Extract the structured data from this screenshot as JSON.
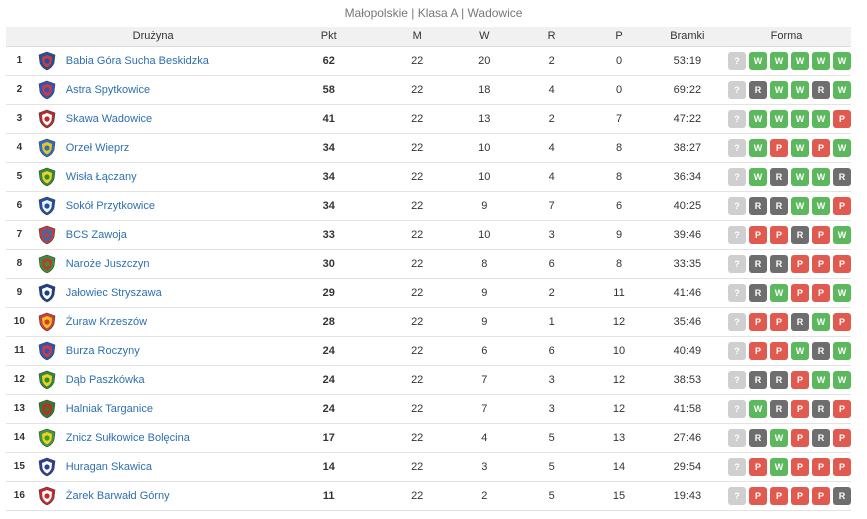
{
  "page_title": "Małopolskie | Klasa A | Wadowice",
  "headers": {
    "team": "Drużyna",
    "pkt": "Pkt",
    "m": "M",
    "w": "W",
    "r": "R",
    "p": "P",
    "goals": "Bramki",
    "form": "Forma"
  },
  "rows": [
    {
      "pos": "1",
      "team": "Babia Góra Sucha Beskidzka",
      "crest": "crest-babia-gora",
      "crest_colors": [
        "#1f4fa3",
        "#d23b3b"
      ],
      "pkt": "62",
      "m": "22",
      "w": "20",
      "r": "2",
      "p": "0",
      "goals": "53:19",
      "form": [
        "?",
        "W",
        "W",
        "W",
        "W",
        "W"
      ]
    },
    {
      "pos": "2",
      "team": "Astra Spytkowice",
      "crest": "crest-astra",
      "crest_colors": [
        "#2a56b8",
        "#d43a3a"
      ],
      "pkt": "58",
      "m": "22",
      "w": "18",
      "r": "4",
      "p": "0",
      "goals": "69:22",
      "form": [
        "?",
        "R",
        "W",
        "W",
        "R",
        "W"
      ]
    },
    {
      "pos": "3",
      "team": "Skawa Wadowice",
      "crest": "crest-skawa",
      "crest_colors": [
        "#b52a2a",
        "#ffffff"
      ],
      "pkt": "41",
      "m": "22",
      "w": "13",
      "r": "2",
      "p": "7",
      "goals": "47:22",
      "form": [
        "?",
        "W",
        "W",
        "W",
        "W",
        "P"
      ]
    },
    {
      "pos": "4",
      "team": "Orzeł Wieprz",
      "crest": "crest-orzel",
      "crest_colors": [
        "#2a6fc7",
        "#f0c419"
      ],
      "pkt": "34",
      "m": "22",
      "w": "10",
      "r": "4",
      "p": "8",
      "goals": "38:27",
      "form": [
        "?",
        "W",
        "P",
        "W",
        "P",
        "W"
      ]
    },
    {
      "pos": "5",
      "team": "Wisła Łączany",
      "crest": "crest-wisla",
      "crest_colors": [
        "#2e8b3d",
        "#f2d21c"
      ],
      "pkt": "34",
      "m": "22",
      "w": "10",
      "r": "4",
      "p": "8",
      "goals": "36:34",
      "form": [
        "?",
        "W",
        "R",
        "W",
        "W",
        "R"
      ]
    },
    {
      "pos": "6",
      "team": "Sokół Przytkowice",
      "crest": "crest-sokol",
      "crest_colors": [
        "#1f4fa3",
        "#f2f2f2"
      ],
      "pkt": "34",
      "m": "22",
      "w": "9",
      "r": "7",
      "p": "6",
      "goals": "40:25",
      "form": [
        "?",
        "R",
        "R",
        "W",
        "W",
        "P"
      ]
    },
    {
      "pos": "7",
      "team": "BCS Zawoja",
      "crest": "crest-bcs",
      "crest_colors": [
        "#c93a3a",
        "#2f6fb0"
      ],
      "pkt": "33",
      "m": "22",
      "w": "10",
      "r": "3",
      "p": "9",
      "goals": "39:46",
      "form": [
        "?",
        "P",
        "P",
        "R",
        "P",
        "W"
      ]
    },
    {
      "pos": "8",
      "team": "Naroże Juszczyn",
      "crest": "crest-naroze",
      "crest_colors": [
        "#3a8f3a",
        "#c0392b"
      ],
      "pkt": "30",
      "m": "22",
      "w": "8",
      "r": "6",
      "p": "8",
      "goals": "33:35",
      "form": [
        "?",
        "R",
        "R",
        "P",
        "P",
        "P"
      ]
    },
    {
      "pos": "9",
      "team": "Jałowiec Stryszawa",
      "crest": "crest-jalowiec",
      "crest_colors": [
        "#1d3f86",
        "#ffffff"
      ],
      "pkt": "29",
      "m": "22",
      "w": "9",
      "r": "2",
      "p": "11",
      "goals": "41:46",
      "form": [
        "?",
        "R",
        "W",
        "P",
        "P",
        "W"
      ]
    },
    {
      "pos": "10",
      "team": "Żuraw Krzeszów",
      "crest": "crest-zuraw",
      "crest_colors": [
        "#d23b3b",
        "#f0c419"
      ],
      "pkt": "28",
      "m": "22",
      "w": "9",
      "r": "1",
      "p": "12",
      "goals": "35:46",
      "form": [
        "?",
        "P",
        "P",
        "R",
        "W",
        "P"
      ]
    },
    {
      "pos": "11",
      "team": "Burza Roczyny",
      "crest": "crest-burza",
      "crest_colors": [
        "#2a56b8",
        "#d43a3a"
      ],
      "pkt": "24",
      "m": "22",
      "w": "6",
      "r": "6",
      "p": "10",
      "goals": "40:49",
      "form": [
        "?",
        "P",
        "P",
        "W",
        "R",
        "W"
      ]
    },
    {
      "pos": "12",
      "team": "Dąb Paszkówka",
      "crest": "crest-dab",
      "crest_colors": [
        "#2e8b3d",
        "#f2d21c"
      ],
      "pkt": "24",
      "m": "22",
      "w": "7",
      "r": "3",
      "p": "12",
      "goals": "38:53",
      "form": [
        "?",
        "R",
        "R",
        "P",
        "W",
        "W"
      ]
    },
    {
      "pos": "13",
      "team": "Halniak Targanice",
      "crest": "crest-halniak",
      "crest_colors": [
        "#2e7d32",
        "#c62828"
      ],
      "pkt": "24",
      "m": "22",
      "w": "7",
      "r": "3",
      "p": "12",
      "goals": "41:58",
      "form": [
        "?",
        "W",
        "R",
        "P",
        "R",
        "P"
      ]
    },
    {
      "pos": "14",
      "team": "Znicz Sułkowice Bolęcina",
      "crest": "crest-znicz",
      "crest_colors": [
        "#3c9a3c",
        "#f2d21c"
      ],
      "pkt": "17",
      "m": "22",
      "w": "4",
      "r": "5",
      "p": "13",
      "goals": "27:46",
      "form": [
        "?",
        "R",
        "W",
        "P",
        "R",
        "P"
      ]
    },
    {
      "pos": "15",
      "team": "Huragan Skawica",
      "crest": "crest-huragan",
      "crest_colors": [
        "#2a3f9a",
        "#ffffff"
      ],
      "pkt": "14",
      "m": "22",
      "w": "3",
      "r": "5",
      "p": "14",
      "goals": "29:54",
      "form": [
        "?",
        "P",
        "W",
        "P",
        "P",
        "P"
      ]
    },
    {
      "pos": "16",
      "team": "Żarek Barwałd Górny",
      "crest": "crest-zarek",
      "crest_colors": [
        "#c62828",
        "#ffffff"
      ],
      "pkt": "11",
      "m": "22",
      "w": "2",
      "r": "5",
      "p": "15",
      "goals": "19:43",
      "form": [
        "?",
        "P",
        "P",
        "P",
        "P",
        "R"
      ]
    }
  ],
  "form_colors": {
    "W": "#5cb85c",
    "R": "#6e6e6e",
    "P": "#e05a4f",
    "?": "#cfcfcf"
  }
}
